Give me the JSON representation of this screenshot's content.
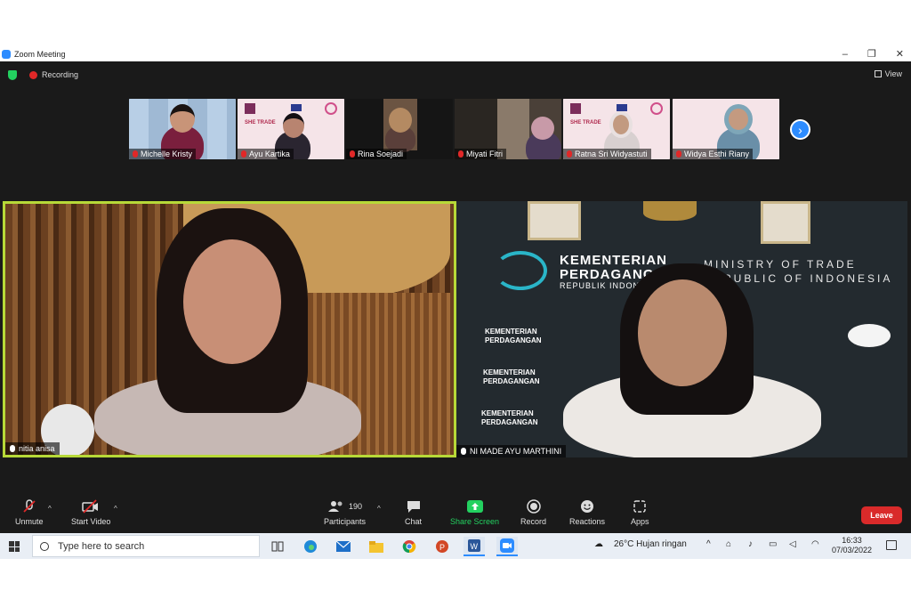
{
  "window": {
    "title": "Zoom Meeting",
    "controls": [
      "–",
      "❐",
      "✕"
    ]
  },
  "topbar": {
    "recording_label": "Recording",
    "view_label": "View"
  },
  "participants_strip": [
    {
      "name": "Michelle Kristy"
    },
    {
      "name": "Ayu Kartika"
    },
    {
      "name": "Rina Soejadi"
    },
    {
      "name": "Miyati Fitri"
    },
    {
      "name": "Ratna Sri Widyastuti"
    },
    {
      "name": "Widya Esthi Riany"
    }
  ],
  "banner_text": "SHE TRADE",
  "main_videos": [
    {
      "name": "nitia anisa"
    },
    {
      "name": "NI MADE AYU MARTHINI"
    }
  ],
  "ministry_wall": {
    "kementerian": "KEMENTERIAN",
    "perdagangan": "PERDAGANGAN",
    "republik": "REPUBLIK INDONESIA",
    "ministry_en_1": "MINISTRY OF TRADE",
    "ministry_en_2": "REPUBLIC OF INDONESIA"
  },
  "toolbar": {
    "unmute": "Unmute",
    "start_video": "Start Video",
    "participants": "Participants",
    "participants_count": "190",
    "chat": "Chat",
    "share_screen": "Share Screen",
    "record": "Record",
    "reactions": "Reactions",
    "apps": "Apps",
    "leave": "Leave"
  },
  "taskbar": {
    "search_placeholder": "Type here to search",
    "weather": "26°C  Hujan ringan",
    "time": "16:33",
    "date": "07/03/2022"
  },
  "colors": {
    "zoom_bg": "#1a1a1a",
    "active_speaker_border": "#b7d938",
    "share_green": "#23d160",
    "leave_red": "#d92a2a",
    "zoom_blue": "#2D8CFF"
  }
}
